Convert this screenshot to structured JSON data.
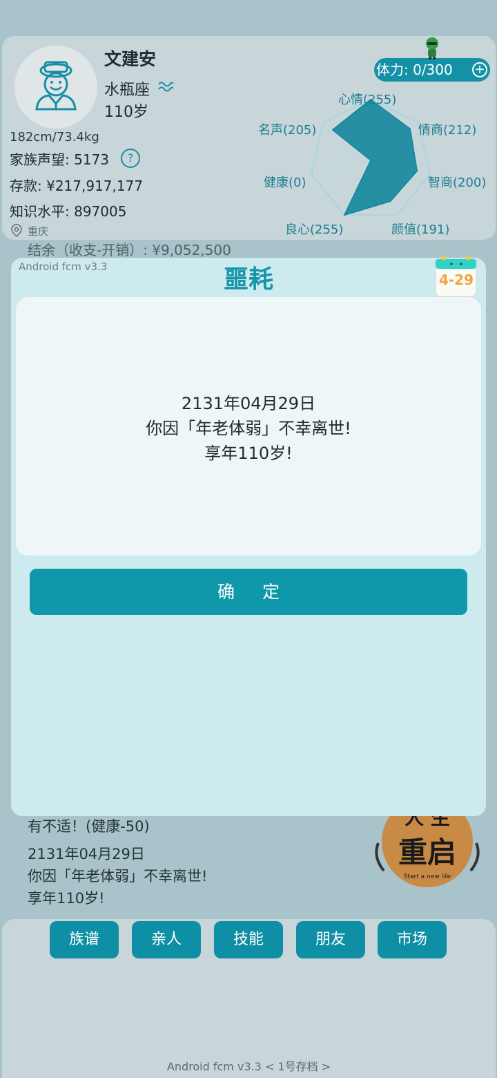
{
  "profile": {
    "name": "文建安",
    "zodiac": "水瓶座",
    "age": "110岁",
    "body_stats": "182cm/73.4kg",
    "family_prestige": "家族声望: 5173",
    "savings": "存款: ¥217,917,177",
    "knowledge": "知识水平: 897005",
    "location": "重庆"
  },
  "stamina": {
    "label": "体力: 0/300",
    "plus": "+"
  },
  "radar": {
    "labels": {
      "mood": "心情(255)",
      "eq": "情商(212)",
      "iq": "智商(200)",
      "looks": "颜值(191)",
      "conscience": "良心(255)",
      "health": "健康(0)",
      "fame": "名声(205)"
    },
    "values": [
      255,
      212,
      200,
      191,
      255,
      0,
      205
    ],
    "max": 255,
    "fill_color": "#0f859c"
  },
  "behind_text": "结余（收支-开销）: ¥9,052,500",
  "modal": {
    "version": "Android fcm v3.3",
    "title": "噩耗",
    "calendar_date": "4-29",
    "line1": "2131年04月29日",
    "line2": "你因「年老体弱」不幸离世!",
    "line3": "享年110岁!",
    "confirm": "确 定"
  },
  "log": {
    "line0": "有不适！(健康-50)",
    "line1": "2131年04月29日",
    "line2": "你因「年老体弱」不幸离世!",
    "line3": "享年110岁!"
  },
  "restart_badge": {
    "text_top": "人 生",
    "text_main": "重启",
    "sub": "Start a new life"
  },
  "nav": [
    "族谱",
    "亲人",
    "技能",
    "朋友",
    "市场"
  ],
  "footer": "Android fcm v3.3  < 1号存档 >",
  "colors": {
    "accent": "#0f97aa",
    "modal_bg": "#cdeaee",
    "card_bg": "#c8d6da"
  }
}
